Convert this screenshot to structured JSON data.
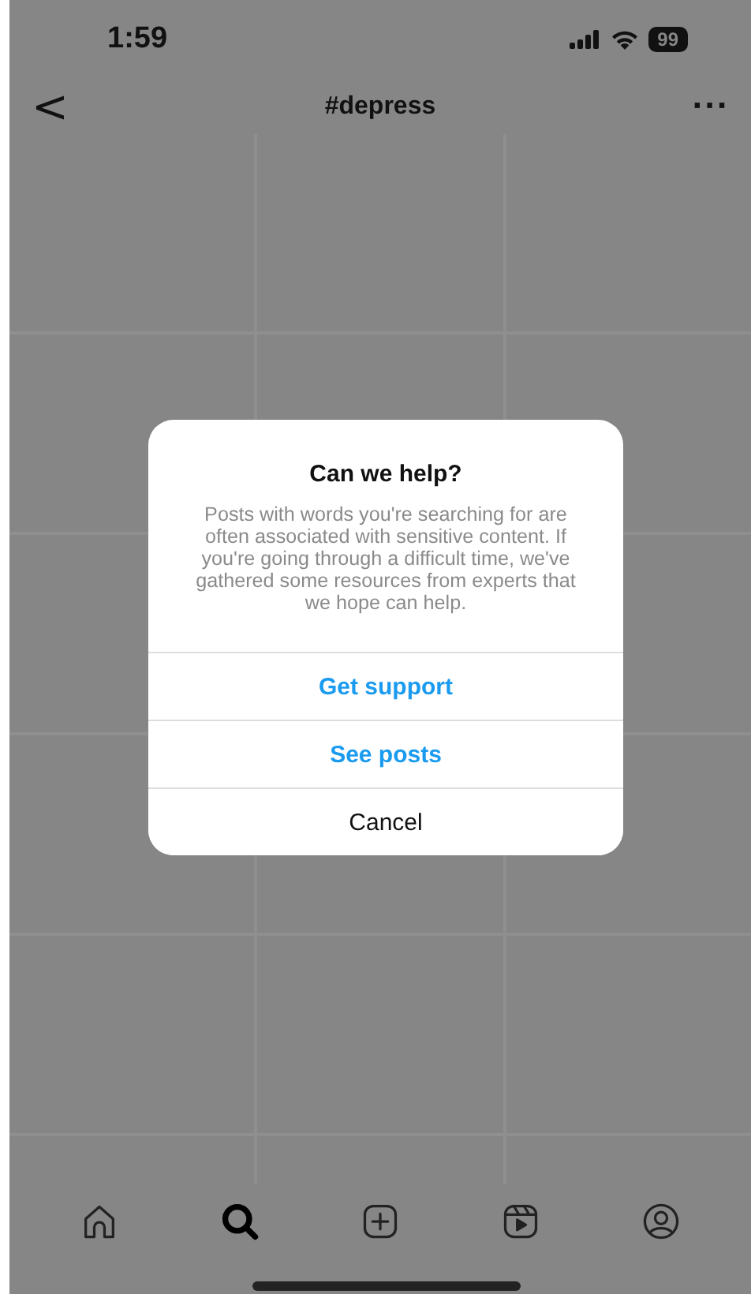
{
  "status_bar": {
    "time": "1:59",
    "battery": "99"
  },
  "header": {
    "back": "<",
    "title": "#depress",
    "more": "···"
  },
  "dialog": {
    "title": "Can we help?",
    "message": "Posts with words you're searching for are often associated with sensitive content. If you're going through a difficult time, we've gathered some resources from experts that we hope can help.",
    "actions": [
      {
        "label": "Get support",
        "kind": "primary"
      },
      {
        "label": "See posts",
        "kind": "primary"
      },
      {
        "label": "Cancel",
        "kind": "plain"
      }
    ]
  },
  "tab_bar": [
    {
      "kind": "home",
      "selected": false
    },
    {
      "kind": "search",
      "selected": true
    },
    {
      "kind": "create",
      "selected": false
    },
    {
      "kind": "reels",
      "selected": false
    },
    {
      "kind": "profile",
      "selected": false
    }
  ]
}
